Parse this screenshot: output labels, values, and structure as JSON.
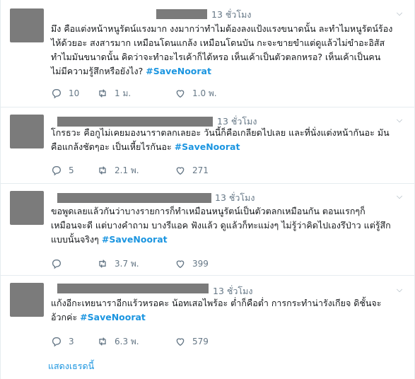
{
  "tweets": [
    {
      "time": "13 ชั่วโมง",
      "lines": [
        "มึง คือแต่งหน้าหนูรัตน์แรงมาก งงมากว่าทำไมต้องลงแป้งแรงขนาดนั้น ละทำไมหนูรัตน์ร้อง",
        "ไห้ด้วยอะ สงสารมาก เหมือนโดนแกล้ง เหมือนโดนบัน กะจะขายขำแต่ดูแล้วไม่ขำอะอิสัส",
        "ทำไมมันขนาดนั้น คิดว่าจะทำอะไรเค้าก็ได้หรอ เห็นเค้าเป็นตัวตลกหรอ? เห็นเค้าเป็นคน",
        "ไม่มีความรู้สึกหรือยังไง?"
      ],
      "hashtag": "#SaveNoorat",
      "replies": "10",
      "retweets": "1 ม.",
      "likes": "1.0 พ."
    },
    {
      "time": "13 ชั่วโมง",
      "lines": [
        "โกรธวะ คือกูไม่เคยมองนาราตลกเลยอะ วันนี้ก็คือเกลียดไปเลย และที่นั่งแต่งหน้ากันอะ มัน",
        "คือแกล้งชัดๆอะ เป็นเหี้ยไรกันอะ"
      ],
      "hashtag": "#SaveNoorat",
      "replies": "5",
      "retweets": "2.1 พ.",
      "likes": "271"
    },
    {
      "time": "13 ชั่วโมง",
      "lines": [
        "ขอพูดเลยแล้วกันว่าบางรายการก็ทำเหมือนหนูรัตน์เป็นตัวตลกเหมือนกัน ตอนแรกๆก็",
        "เหมือนจะดี แต่บางคำถาม บางรีแอค ฟังแล้ว ดูแล้วก็ทะแม่งๆ ไม่รู้ว่าคิดไปเองรึป่าว แต่รู้สึก",
        "แบบนั้นจริงๆ"
      ],
      "hashtag": "#SaveNoorat",
      "replies": "",
      "retweets": "3.7 พ.",
      "likes": "399"
    },
    {
      "time": "13 ชั่วโมง",
      "lines": [
        "แก้งอีกะเทยนาราอีกแร้วหรอคะ น้อทเสอไพร้อะ ต่ำก็คือต่ำ การกระทำน่ารังเกียจ ดิชั้นจะ",
        "อ้วกค่ะ"
      ],
      "hashtag": "#SaveNoorat",
      "replies": "3",
      "retweets": "6.3 พ.",
      "likes": "579"
    }
  ],
  "show_thread": "แสดงเธรดนี้",
  "icons": {
    "reply": "reply-icon",
    "retweet": "retweet-icon",
    "like": "heart-icon",
    "caret": "chevron-down-icon"
  },
  "colors": {
    "hashtag": "#1b95e0",
    "meta": "#657786",
    "redaction": "#7b7b7b"
  }
}
